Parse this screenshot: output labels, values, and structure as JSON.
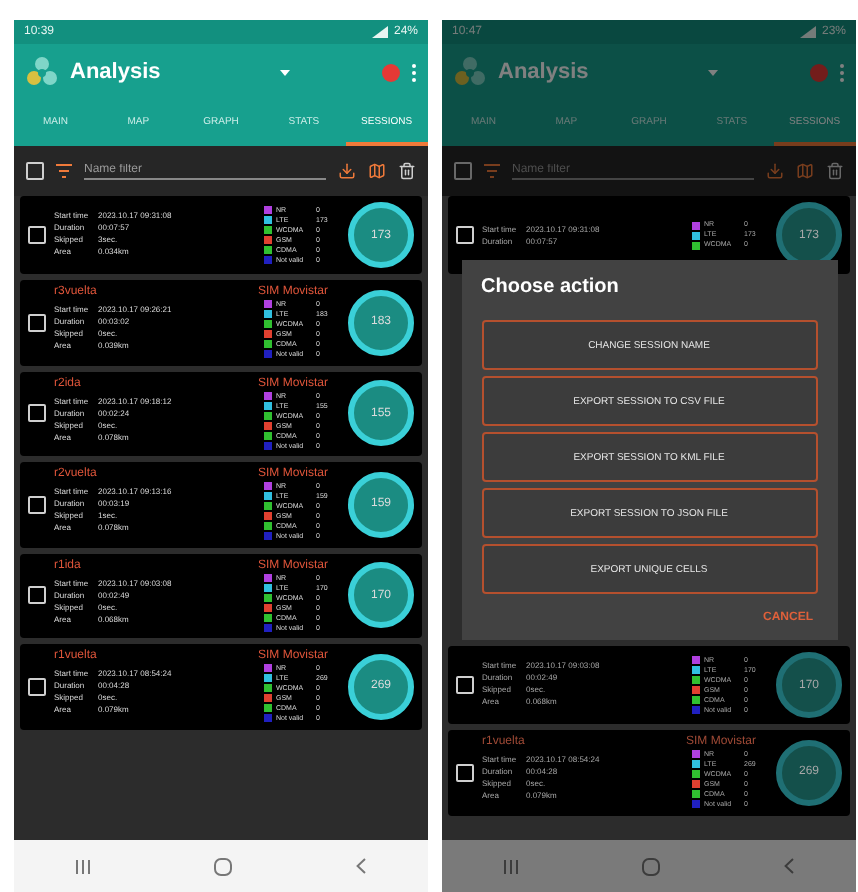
{
  "screens": [
    {
      "dimmed": false,
      "status_bar": {
        "time": "10:39",
        "battery": "24%"
      },
      "app_bar": {
        "title": "Analysis"
      },
      "tabs": [
        {
          "label": "MAIN",
          "selected": false
        },
        {
          "label": "MAP",
          "selected": false
        },
        {
          "label": "GRAPH",
          "selected": false
        },
        {
          "label": "STATS",
          "selected": false
        },
        {
          "label": "SESSIONS",
          "selected": true
        }
      ],
      "filter": {
        "checked": false,
        "placeholder": "Name filter"
      },
      "sessions_above": [
        {
          "checked": false,
          "fields": [
            {
              "label": "Start time",
              "value": "2023.10.17 09:31:08"
            },
            {
              "label": "Duration",
              "value": "00:07:57"
            },
            {
              "label": "Skipped",
              "value": "3sec."
            },
            {
              "label": "Area",
              "value": "0.034km"
            }
          ],
          "legend": [
            {
              "label": "NR",
              "value": "0",
              "color": "#b040e0"
            },
            {
              "label": "LTE",
              "value": "173",
              "color": "#30c0e0"
            },
            {
              "label": "WCDMA",
              "value": "0",
              "color": "#30c030"
            },
            {
              "label": "GSM",
              "value": "0",
              "color": "#e04030"
            },
            {
              "label": "CDMA",
              "value": "0",
              "color": "#30c030"
            },
            {
              "label": "Not valid",
              "value": "0",
              "color": "#2020c0"
            }
          ],
          "count": "173"
        },
        {
          "checked": false,
          "title": "r3vuelta",
          "operator": "SIM Movistar",
          "fields": [
            {
              "label": "Start time",
              "value": "2023.10.17 09:26:21"
            },
            {
              "label": "Duration",
              "value": "00:03:02"
            },
            {
              "label": "Skipped",
              "value": "0sec."
            },
            {
              "label": "Area",
              "value": "0.039km"
            }
          ],
          "legend": [
            {
              "label": "NR",
              "value": "0",
              "color": "#b040e0"
            },
            {
              "label": "LTE",
              "value": "183",
              "color": "#30c0e0"
            },
            {
              "label": "WCDMA",
              "value": "0",
              "color": "#30c030"
            },
            {
              "label": "GSM",
              "value": "0",
              "color": "#e04030"
            },
            {
              "label": "CDMA",
              "value": "0",
              "color": "#30c030"
            },
            {
              "label": "Not valid",
              "value": "0",
              "color": "#2020c0"
            }
          ],
          "count": "183"
        },
        {
          "checked": false,
          "title": "r2ida",
          "operator": "SIM Movistar",
          "fields": [
            {
              "label": "Start time",
              "value": "2023.10.17 09:18:12"
            },
            {
              "label": "Duration",
              "value": "00:02:24"
            },
            {
              "label": "Skipped",
              "value": "0sec."
            },
            {
              "label": "Area",
              "value": "0.078km"
            }
          ],
          "legend": [
            {
              "label": "NR",
              "value": "0",
              "color": "#b040e0"
            },
            {
              "label": "LTE",
              "value": "155",
              "color": "#30c0e0"
            },
            {
              "label": "WCDMA",
              "value": "0",
              "color": "#30c030"
            },
            {
              "label": "GSM",
              "value": "0",
              "color": "#e04030"
            },
            {
              "label": "CDMA",
              "value": "0",
              "color": "#30c030"
            },
            {
              "label": "Not valid",
              "value": "0",
              "color": "#2020c0"
            }
          ],
          "count": "155"
        },
        {
          "checked": false,
          "title": "r2vuelta",
          "operator": "SIM Movistar",
          "fields": [
            {
              "label": "Start time",
              "value": "2023.10.17 09:13:16"
            },
            {
              "label": "Duration",
              "value": "00:03:19"
            },
            {
              "label": "Skipped",
              "value": "1sec."
            },
            {
              "label": "Area",
              "value": "0.078km"
            }
          ],
          "legend": [
            {
              "label": "NR",
              "value": "0",
              "color": "#b040e0"
            },
            {
              "label": "LTE",
              "value": "159",
              "color": "#30c0e0"
            },
            {
              "label": "WCDMA",
              "value": "0",
              "color": "#30c030"
            },
            {
              "label": "GSM",
              "value": "0",
              "color": "#e04030"
            },
            {
              "label": "CDMA",
              "value": "0",
              "color": "#30c030"
            },
            {
              "label": "Not valid",
              "value": "0",
              "color": "#2020c0"
            }
          ],
          "count": "159"
        },
        {
          "checked": false,
          "title": "r1ida",
          "operator": "SIM Movistar",
          "fields": [
            {
              "label": "Start time",
              "value": "2023.10.17 09:03:08"
            },
            {
              "label": "Duration",
              "value": "00:02:49"
            },
            {
              "label": "Skipped",
              "value": "0sec."
            },
            {
              "label": "Area",
              "value": "0.068km"
            }
          ],
          "legend": [
            {
              "label": "NR",
              "value": "0",
              "color": "#b040e0"
            },
            {
              "label": "LTE",
              "value": "170",
              "color": "#30c0e0"
            },
            {
              "label": "WCDMA",
              "value": "0",
              "color": "#30c030"
            },
            {
              "label": "GSM",
              "value": "0",
              "color": "#e04030"
            },
            {
              "label": "CDMA",
              "value": "0",
              "color": "#30c030"
            },
            {
              "label": "Not valid",
              "value": "0",
              "color": "#2020c0"
            }
          ],
          "count": "170"
        },
        {
          "checked": false,
          "title": "r1vuelta",
          "operator": "SIM Movistar",
          "fields": [
            {
              "label": "Start time",
              "value": "2023.10.17 08:54:24"
            },
            {
              "label": "Duration",
              "value": "00:04:28"
            },
            {
              "label": "Skipped",
              "value": "0sec."
            },
            {
              "label": "Area",
              "value": "0.079km"
            }
          ],
          "legend": [
            {
              "label": "NR",
              "value": "0",
              "color": "#b040e0"
            },
            {
              "label": "LTE",
              "value": "269",
              "color": "#30c0e0"
            },
            {
              "label": "WCDMA",
              "value": "0",
              "color": "#30c030"
            },
            {
              "label": "GSM",
              "value": "0",
              "color": "#e04030"
            },
            {
              "label": "CDMA",
              "value": "0",
              "color": "#30c030"
            },
            {
              "label": "Not valid",
              "value": "0",
              "color": "#2020c0"
            }
          ],
          "count": "269"
        }
      ]
    },
    {
      "dimmed": true,
      "status_bar": {
        "time": "10:47",
        "battery": "23%"
      },
      "app_bar": {
        "title": "Analysis"
      },
      "tabs": [
        {
          "label": "MAIN",
          "selected": false
        },
        {
          "label": "MAP",
          "selected": false
        },
        {
          "label": "GRAPH",
          "selected": false
        },
        {
          "label": "STATS",
          "selected": false
        },
        {
          "label": "SESSIONS",
          "selected": true
        }
      ],
      "filter": {
        "checked": false,
        "placeholder": "Name filter"
      },
      "sessions_above": [
        {
          "checked": false,
          "fields": [
            {
              "label": "Start time",
              "value": "2023.10.17 09:31:08"
            },
            {
              "label": "Duration",
              "value": "00:07:57"
            }
          ],
          "legend": [
            {
              "label": "NR",
              "value": "0",
              "color": "#b040e0"
            },
            {
              "label": "LTE",
              "value": "173",
              "color": "#30c0e0"
            },
            {
              "label": "WCDMA",
              "value": "0",
              "color": "#30c030"
            }
          ],
          "count": "173"
        }
      ],
      "dialog": {
        "title": "Choose action",
        "actions": [
          "CHANGE SESSION NAME",
          "EXPORT SESSION TO CSV FILE",
          "EXPORT SESSION TO KML FILE",
          "EXPORT SESSION TO JSON FILE",
          "EXPORT UNIQUE CELLS"
        ],
        "cancel": "CANCEL"
      },
      "sessions_below": [
        {
          "checked": false,
          "fields": [
            {
              "label": "Start time",
              "value": "2023.10.17 09:03:08"
            },
            {
              "label": "Duration",
              "value": "00:02:49"
            },
            {
              "label": "Skipped",
              "value": "0sec."
            },
            {
              "label": "Area",
              "value": "0.068km"
            }
          ],
          "legend": [
            {
              "label": "NR",
              "value": "0",
              "color": "#b040e0"
            },
            {
              "label": "LTE",
              "value": "170",
              "color": "#30c0e0"
            },
            {
              "label": "WCDMA",
              "value": "0",
              "color": "#30c030"
            },
            {
              "label": "GSM",
              "value": "0",
              "color": "#e04030"
            },
            {
              "label": "CDMA",
              "value": "0",
              "color": "#30c030"
            },
            {
              "label": "Not valid",
              "value": "0",
              "color": "#2020c0"
            }
          ],
          "count": "170"
        },
        {
          "checked": false,
          "title": "r1vuelta",
          "operator": "SIM Movistar",
          "fields": [
            {
              "label": "Start time",
              "value": "2023.10.17 08:54:24"
            },
            {
              "label": "Duration",
              "value": "00:04:28"
            },
            {
              "label": "Skipped",
              "value": "0sec."
            },
            {
              "label": "Area",
              "value": "0.079km"
            }
          ],
          "legend": [
            {
              "label": "NR",
              "value": "0",
              "color": "#b040e0"
            },
            {
              "label": "LTE",
              "value": "269",
              "color": "#30c0e0"
            },
            {
              "label": "WCDMA",
              "value": "0",
              "color": "#30c030"
            },
            {
              "label": "GSM",
              "value": "0",
              "color": "#e04030"
            },
            {
              "label": "CDMA",
              "value": "0",
              "color": "#30c030"
            },
            {
              "label": "Not valid",
              "value": "0",
              "color": "#2020c0"
            }
          ],
          "count": "269"
        }
      ]
    }
  ]
}
